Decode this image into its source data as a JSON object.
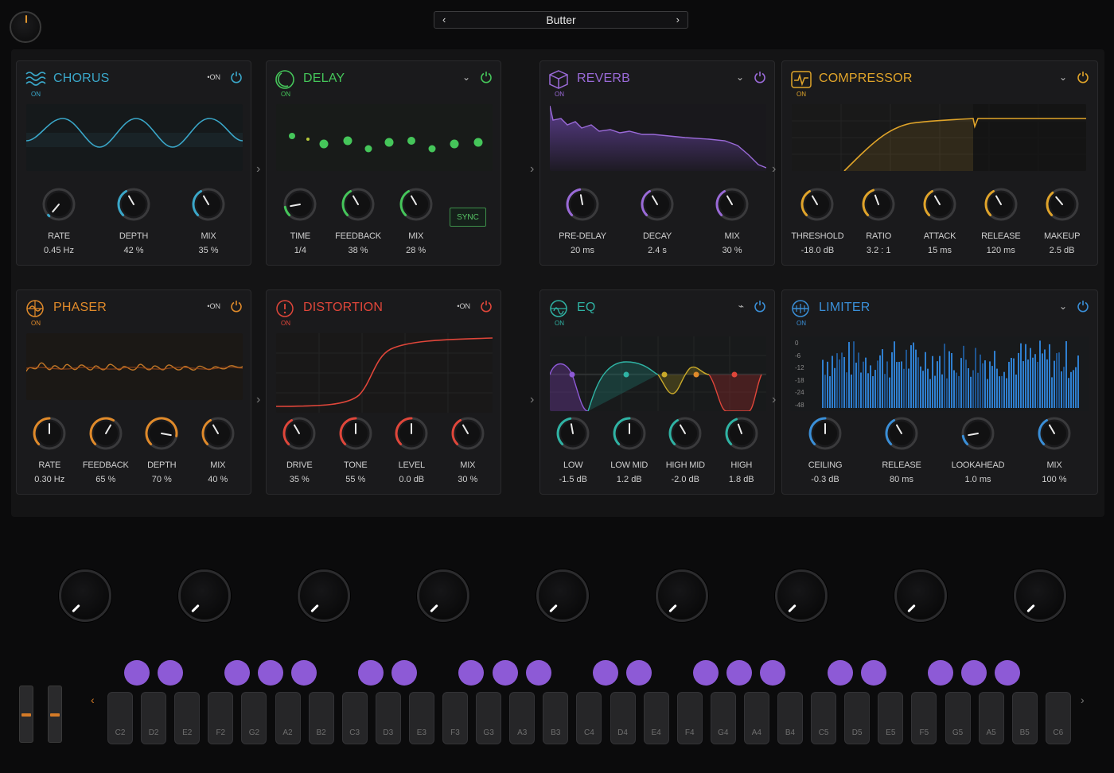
{
  "header": {
    "preset_name": "Butter",
    "prev_arrow": "‹",
    "next_arrow": "›"
  },
  "panels": {
    "chorus": {
      "title": "CHORUS",
      "on": "ON",
      "toggle": "•ON",
      "color": "#3aa7c9",
      "knobs": [
        {
          "label": "RATE",
          "value": "0.45 Hz"
        },
        {
          "label": "DEPTH",
          "value": "42 %"
        },
        {
          "label": "MIX",
          "value": "35 %"
        }
      ]
    },
    "delay": {
      "title": "DELAY",
      "on": "ON",
      "color": "#45c65a",
      "sync": "SYNC",
      "knobs": [
        {
          "label": "TIME",
          "value": "1/4"
        },
        {
          "label": "FEEDBACK",
          "value": "38 %"
        },
        {
          "label": "MIX",
          "value": "28 %"
        }
      ]
    },
    "reverb": {
      "title": "REVERB",
      "on": "ON",
      "color": "#9a6ad8",
      "knobs": [
        {
          "label": "PRE-DELAY",
          "value": "20 ms"
        },
        {
          "label": "DECAY",
          "value": "2.4 s"
        },
        {
          "label": "MIX",
          "value": "30 %"
        }
      ]
    },
    "compressor": {
      "title": "COMPRESSOR",
      "on": "ON",
      "color": "#e0a42a",
      "knobs": [
        {
          "label": "THRESHOLD",
          "value": "-18.0 dB"
        },
        {
          "label": "RATIO",
          "value": "3.2 : 1"
        },
        {
          "label": "ATTACK",
          "value": "15 ms"
        },
        {
          "label": "RELEASE",
          "value": "120 ms"
        },
        {
          "label": "MAKEUP",
          "value": "2.5 dB"
        }
      ]
    },
    "phaser": {
      "title": "PHASER",
      "on": "ON",
      "toggle": "•ON",
      "color": "#e08a2a",
      "knobs": [
        {
          "label": "RATE",
          "value": "0.30 Hz"
        },
        {
          "label": "FEEDBACK",
          "value": "65 %"
        },
        {
          "label": "DEPTH",
          "value": "70 %"
        },
        {
          "label": "MIX",
          "value": "40 %"
        }
      ]
    },
    "distortion": {
      "title": "DISTORTION",
      "on": "ON",
      "toggle": "•ON",
      "color": "#e0463a",
      "knobs": [
        {
          "label": "DRIVE",
          "value": "35 %"
        },
        {
          "label": "TONE",
          "value": "55 %"
        },
        {
          "label": "LEVEL",
          "value": "0.0 dB"
        },
        {
          "label": "MIX",
          "value": "30 %"
        }
      ]
    },
    "eq": {
      "title": "EQ",
      "on": "ON",
      "color": "#2fb3a4",
      "knobs": [
        {
          "label": "LOW",
          "value": "-1.5 dB"
        },
        {
          "label": "LOW MID",
          "value": "1.2 dB"
        },
        {
          "label": "HIGH MID",
          "value": "-2.0 dB"
        },
        {
          "label": "HIGH",
          "value": "1.8 dB"
        }
      ]
    },
    "limiter": {
      "title": "LIMITER",
      "on": "ON",
      "color": "#3a8fd8",
      "scale": [
        "0",
        "-6",
        "-12",
        "-18",
        "-24",
        "-48"
      ],
      "knobs": [
        {
          "label": "CEILING",
          "value": "-0.3 dB"
        },
        {
          "label": "RELEASE",
          "value": "80 ms"
        },
        {
          "label": "LOOKAHEAD",
          "value": "1.0 ms"
        },
        {
          "label": "MIX",
          "value": "100 %"
        }
      ]
    }
  },
  "keyboard": {
    "keys": [
      "C2",
      "D2",
      "E2",
      "F2",
      "G2",
      "A2",
      "B2",
      "C3",
      "D3",
      "E3",
      "F3",
      "G3",
      "A3",
      "B3",
      "C4",
      "D4",
      "E4",
      "F4",
      "G4",
      "A4",
      "B4",
      "C5",
      "D5",
      "E5",
      "F5",
      "G5",
      "A5",
      "B5",
      "C6"
    ],
    "prev": "‹",
    "next": "›"
  },
  "colors": {
    "accent_purple": "#8d5ad6",
    "fader_cap": "#d57b27"
  }
}
